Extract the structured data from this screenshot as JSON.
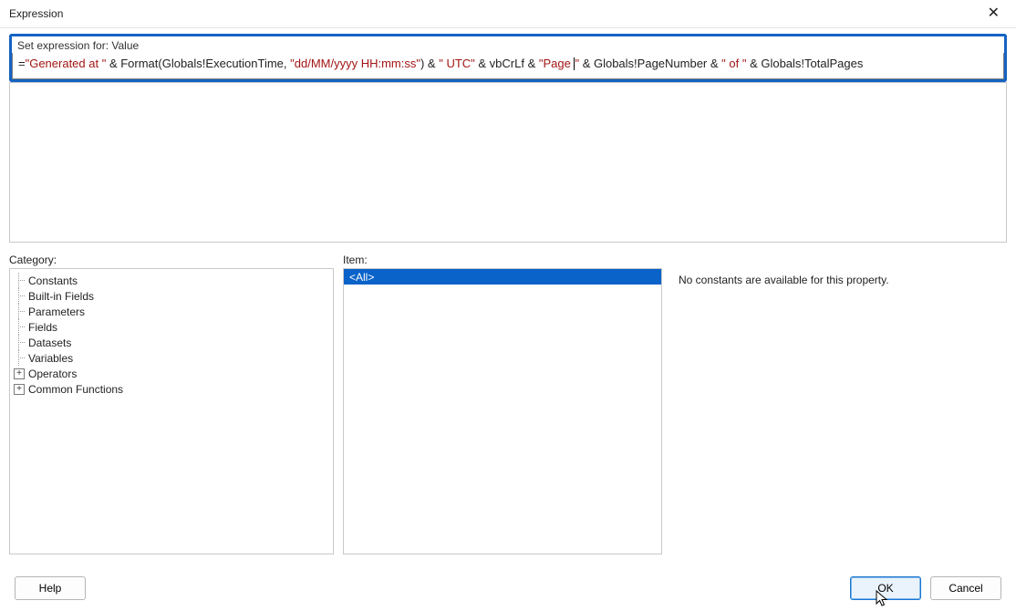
{
  "window": {
    "title": "Expression",
    "close_glyph": "✕"
  },
  "set_expression_label": "Set expression for: Value",
  "expression_tokens": [
    {
      "t": "plain",
      "v": "="
    },
    {
      "t": "str",
      "v": "\"Generated at \""
    },
    {
      "t": "plain",
      "v": " & Format(Globals!ExecutionTime, "
    },
    {
      "t": "str",
      "v": "\"dd/MM/yyyy HH:mm:ss\""
    },
    {
      "t": "plain",
      "v": ") & "
    },
    {
      "t": "str",
      "v": "\" UTC\""
    },
    {
      "t": "plain",
      "v": " & vbCrLf & "
    },
    {
      "t": "str",
      "v": "\"Page "
    },
    {
      "t": "caret",
      "v": ""
    },
    {
      "t": "str",
      "v": "\""
    },
    {
      "t": "plain",
      "v": " & Globals!PageNumber & "
    },
    {
      "t": "str",
      "v": "\" of \""
    },
    {
      "t": "plain",
      "v": " & Globals!TotalPages"
    }
  ],
  "labels": {
    "category": "Category:",
    "item": "Item:"
  },
  "category_tree": [
    {
      "label": "Constants",
      "expandable": false
    },
    {
      "label": "Built-in Fields",
      "expandable": false
    },
    {
      "label": "Parameters",
      "expandable": false
    },
    {
      "label": "Fields",
      "expandable": false
    },
    {
      "label": "Datasets",
      "expandable": false
    },
    {
      "label": "Variables",
      "expandable": false
    },
    {
      "label": "Operators",
      "expandable": true
    },
    {
      "label": "Common Functions",
      "expandable": true
    }
  ],
  "item_list": [
    {
      "label": "<All>",
      "selected": true
    }
  ],
  "description_text": "No constants are available for this property.",
  "buttons": {
    "help": "Help",
    "ok": "OK",
    "cancel": "Cancel"
  }
}
